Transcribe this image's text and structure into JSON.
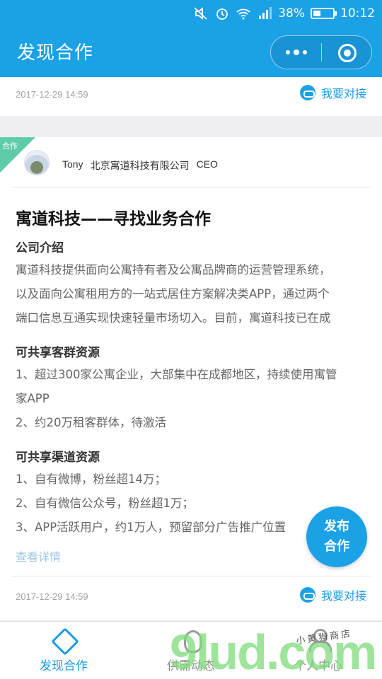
{
  "status_bar": {
    "battery_text": "38%",
    "battery_level": 0.38,
    "time": "10:12",
    "icons": [
      "mute-icon",
      "alarm-icon",
      "wifi-icon",
      "signal-icon",
      "battery-icon"
    ]
  },
  "header": {
    "title": "发现合作",
    "capsule_icons": [
      "more-icon",
      "close-target-icon"
    ]
  },
  "prev_card": {
    "date": "2017-12-29 14:59",
    "connect_label": "我要对接"
  },
  "post": {
    "ribbon": "合作",
    "author_name": "Tony",
    "company": "北京寓道科技有限公司",
    "role": "CEO",
    "title": "寓道科技——寻找业务合作",
    "section1_title": "公司介绍",
    "section1_lines": [
      "寓道科技提供面向公寓持有者及公寓品牌商的运营管理系统，",
      "以及面向公寓租用方的一站式居住方案解决类APP，通过两个",
      "端口信息互通实现快速轻量市场切入。目前，寓道科技已在成"
    ],
    "section2_title": "可共享客群资源",
    "section2_lines": [
      "1、超过300家公寓企业，大部集中在成都地区，持续使用寓管",
      "家APP",
      "2、约20万租客群体，待激活"
    ],
    "section3_title": "可共享渠道资源",
    "section3_lines": [
      "1、自有微博，粉丝超14万；",
      "2、自有微信公众号，粉丝超1万；",
      "3、APP活跃用户，约1万人，预留部分广告推广位置"
    ],
    "more_label": "查看详情",
    "date": "2017-12-29 14:59",
    "connect_label": "我要对接"
  },
  "fab": {
    "line1": "发布",
    "line2": "合作"
  },
  "tabbar": {
    "tabs": [
      {
        "label": "发现合作",
        "icon": "handshake-icon",
        "active": true
      },
      {
        "label": "供需动态",
        "icon": "leaf-icon",
        "active": false
      },
      {
        "label": "个人中心",
        "icon": "person-icon",
        "active": false
      }
    ]
  },
  "watermark": {
    "main": "9lud.com",
    "small": "小黄狗商店"
  },
  "colors": {
    "brand": "#1ba1e6",
    "ribbon": "#5fcca9",
    "link": "#1b9be3"
  }
}
